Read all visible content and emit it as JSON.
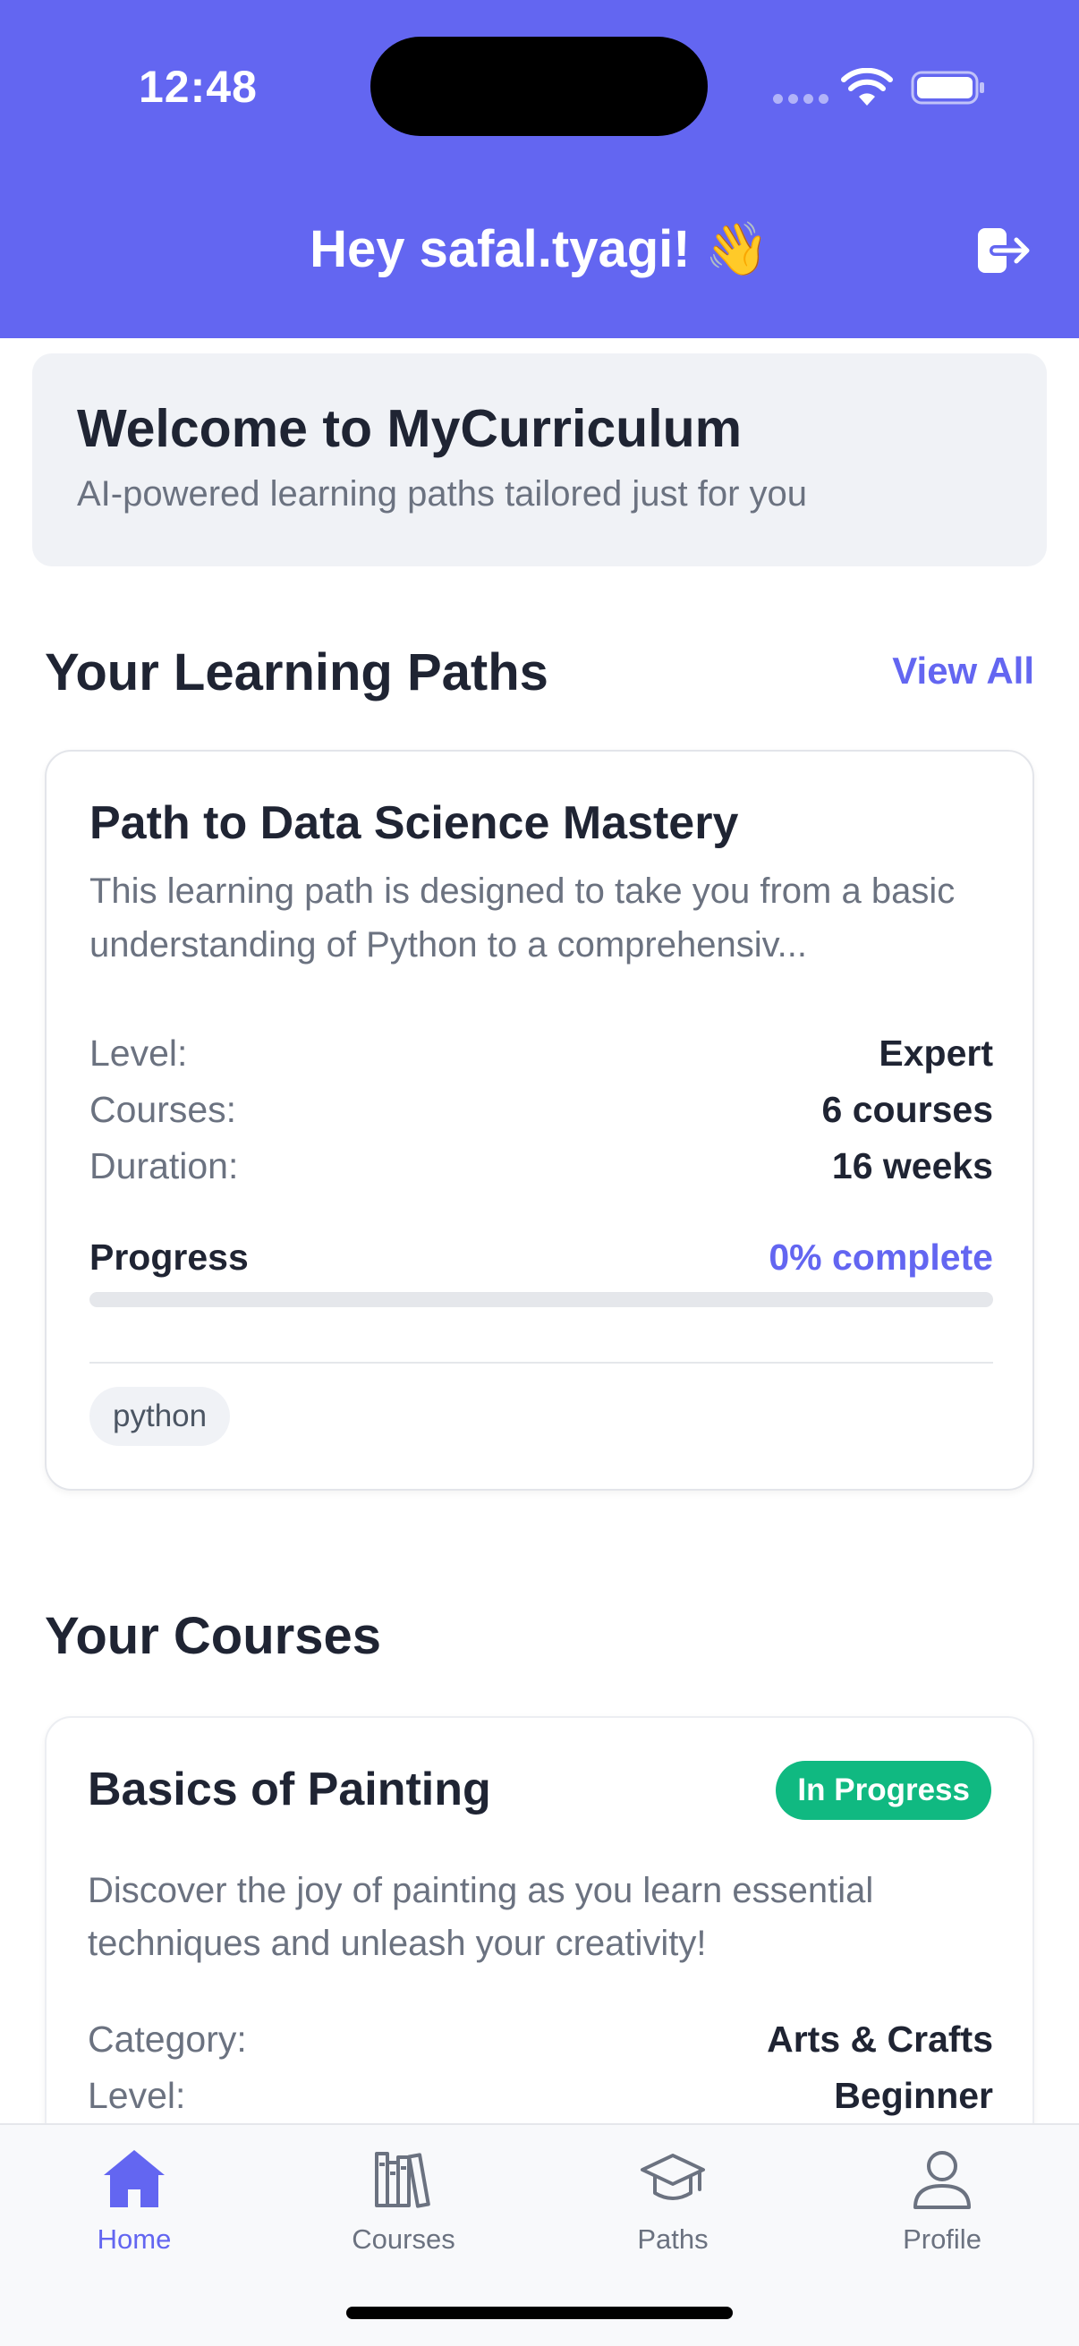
{
  "status_bar": {
    "time": "12:48"
  },
  "header": {
    "greeting": "Hey safal.tyagi! 👋",
    "logout_icon": "logout-icon"
  },
  "welcome": {
    "title": "Welcome to MyCurriculum",
    "subtitle": "AI-powered learning paths tailored just for you"
  },
  "paths_section": {
    "title": "Your Learning Paths",
    "view_all": "View All",
    "card": {
      "title": "Path to Data Science Mastery",
      "description": "This learning path is designed to take you from a basic understanding of Python to a comprehensiv...",
      "level_label": "Level:",
      "level_value": "Expert",
      "courses_label": "Courses:",
      "courses_value": "6 courses",
      "duration_label": "Duration:",
      "duration_value": "16 weeks",
      "progress_label": "Progress",
      "progress_value": "0% complete",
      "progress_fraction": 0,
      "tag": "python"
    }
  },
  "courses_section": {
    "title": "Your Courses",
    "card": {
      "title": "Basics of Painting",
      "status": "In Progress",
      "description": "Discover the joy of painting as you learn essential techniques and unleash your creativity!",
      "category_label": "Category:",
      "category_value": "Arts & Crafts",
      "level_label": "Level:",
      "level_value": "Beginner"
    }
  },
  "tabbar": {
    "tabs": [
      {
        "label": "Home",
        "icon": "home-icon",
        "active": true
      },
      {
        "label": "Courses",
        "icon": "books-icon",
        "active": false
      },
      {
        "label": "Paths",
        "icon": "graduation-cap-icon",
        "active": false
      },
      {
        "label": "Profile",
        "icon": "user-icon",
        "active": false
      }
    ]
  },
  "colors": {
    "brand": "#6366f1",
    "success": "#10b981",
    "muted_text": "#6b7280"
  }
}
